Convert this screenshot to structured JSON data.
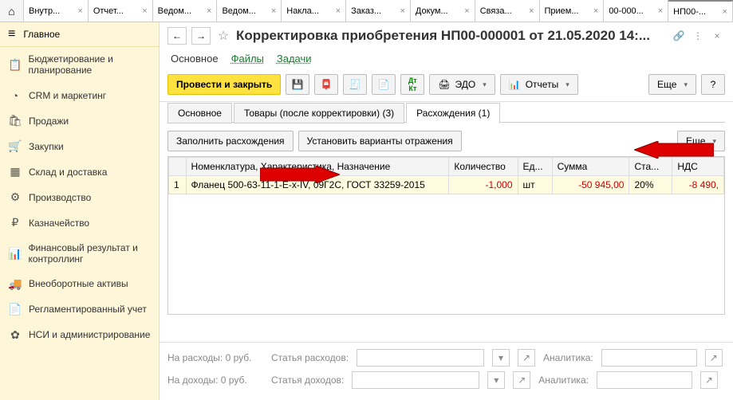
{
  "tabs": {
    "items": [
      {
        "label": "Внутр..."
      },
      {
        "label": "Отчет..."
      },
      {
        "label": "Ведом..."
      },
      {
        "label": "Ведом..."
      },
      {
        "label": "Накла..."
      },
      {
        "label": "Заказ..."
      },
      {
        "label": "Докум..."
      },
      {
        "label": "Связа..."
      },
      {
        "label": "Прием..."
      },
      {
        "label": "00-000..."
      },
      {
        "label": "НП00-..."
      }
    ]
  },
  "sidebar": {
    "top": "Главное",
    "items": [
      {
        "label": "Бюджетирование и планирование",
        "icon": "📋"
      },
      {
        "label": "CRM и маркетинг",
        "icon": "◔"
      },
      {
        "label": "Продажи",
        "icon": "🛍"
      },
      {
        "label": "Закупки",
        "icon": "🛒"
      },
      {
        "label": "Склад и доставка",
        "icon": "▦"
      },
      {
        "label": "Производство",
        "icon": "⚙"
      },
      {
        "label": "Казначейство",
        "icon": "₽"
      },
      {
        "label": "Финансовый результат и контроллинг",
        "icon": "📊"
      },
      {
        "label": "Внеоборотные активы",
        "icon": "🚚"
      },
      {
        "label": "Регламентированный учет",
        "icon": "📄"
      },
      {
        "label": "НСИ и администрирование",
        "icon": "✿"
      }
    ]
  },
  "header": {
    "title": "Корректировка приобретения НП00-000001 от 21.05.2020 14:..."
  },
  "subnav": {
    "items": [
      {
        "label": "Основное",
        "active": true
      },
      {
        "label": "Файлы",
        "active": false
      },
      {
        "label": "Задачи",
        "active": false
      }
    ]
  },
  "toolbar": {
    "primary": "Провести и закрыть",
    "edo": "ЭДО",
    "reports": "Отчеты",
    "more": "Еще",
    "help": "?"
  },
  "inner_tabs": {
    "items": [
      {
        "label": "Основное"
      },
      {
        "label": "Товары (после корректировки) (3)"
      },
      {
        "label": "Расхождения (1)"
      }
    ]
  },
  "content_toolbar": {
    "fill": "Заполнить расхождения",
    "variants": "Установить варианты отражения",
    "more": "Еще"
  },
  "table": {
    "headers": {
      "num": "",
      "name": "Номенклатура, Характеристика, Назначение",
      "qty": "Количество",
      "unit": "Ед...",
      "sum": "Сумма",
      "rate": "Ста...",
      "vat": "НДС"
    },
    "rows": [
      {
        "n": "1",
        "name": "Фланец 500-63-11-1-E-х-IV, 09Г2С, ГОСТ 33259-2015",
        "qty": "-1,000",
        "unit": "шт",
        "sum": "-50 945,00",
        "rate": "20%",
        "vat": "-8 490,"
      }
    ]
  },
  "footer": {
    "exp_label": "На расходы: 0 руб.",
    "inc_label": "На доходы: 0 руб.",
    "article_exp": "Статья расходов:",
    "article_inc": "Статья доходов:",
    "analytics": "Аналитика:"
  }
}
